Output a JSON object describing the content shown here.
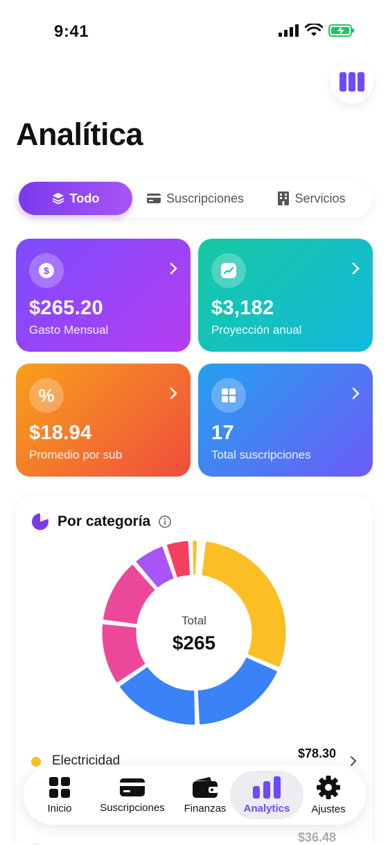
{
  "status_bar": {
    "time": "9:41"
  },
  "page": {
    "title": "Analítica"
  },
  "tabs": [
    {
      "label": "Todo",
      "icon": "layers-icon",
      "active": true
    },
    {
      "label": "Suscripciones",
      "icon": "credit-card-icon",
      "active": false
    },
    {
      "label": "Servicios",
      "icon": "building-icon",
      "active": false
    }
  ],
  "cards": [
    {
      "value": "$265.20",
      "label": "Gasto Mensual",
      "icon": "dollar-icon",
      "gradient": [
        "#7b4dff",
        "#b53cf0"
      ]
    },
    {
      "value": "$3,182",
      "label": "Proyección anual",
      "icon": "trend-chart-icon",
      "gradient": [
        "#17c9a3",
        "#12b8dc"
      ]
    },
    {
      "value": "$18.94",
      "label": "Promedio por sub",
      "icon": "percent-icon",
      "gradient": [
        "#f9a01b",
        "#ef4d3e"
      ]
    },
    {
      "value": "17",
      "label": "Total suscripciones",
      "icon": "grid-icon",
      "gradient": [
        "#25a0f0",
        "#6c5cf7"
      ]
    }
  ],
  "category": {
    "title": "Por categoría",
    "total_label": "Total",
    "total_value": "$265",
    "legend": [
      {
        "name": "Electricidad",
        "amount": "$78.30",
        "color": "#f8c02a"
      },
      {
        "name": "",
        "amount": "$36.48",
        "color": "#bfdbfe"
      }
    ]
  },
  "chart_data": {
    "type": "pie",
    "categories": [
      "Electricidad",
      "",
      "",
      "",
      "",
      "",
      "",
      "",
      ""
    ],
    "values": [
      78.3,
      47,
      42,
      30,
      31,
      16,
      12,
      4,
      2
    ],
    "colors": [
      "#fbbf24",
      "#3b82f6",
      "#3b82f6",
      "#ec4899",
      "#ec4899",
      "#a855f7",
      "#f43f5e",
      "#fbbf24",
      "#0ea5e9"
    ],
    "title": "Por categoría"
  },
  "nav": [
    {
      "label": "Inicio",
      "icon": "grid-icon",
      "active": false
    },
    {
      "label": "Suscripciones",
      "icon": "credit-card-icon",
      "active": false
    },
    {
      "label": "Finanzas",
      "icon": "wallet-icon",
      "active": false
    },
    {
      "label": "Analytics",
      "icon": "bar-chart-icon",
      "active": true
    },
    {
      "label": "Ajustes",
      "icon": "gear-icon",
      "active": false
    }
  ]
}
